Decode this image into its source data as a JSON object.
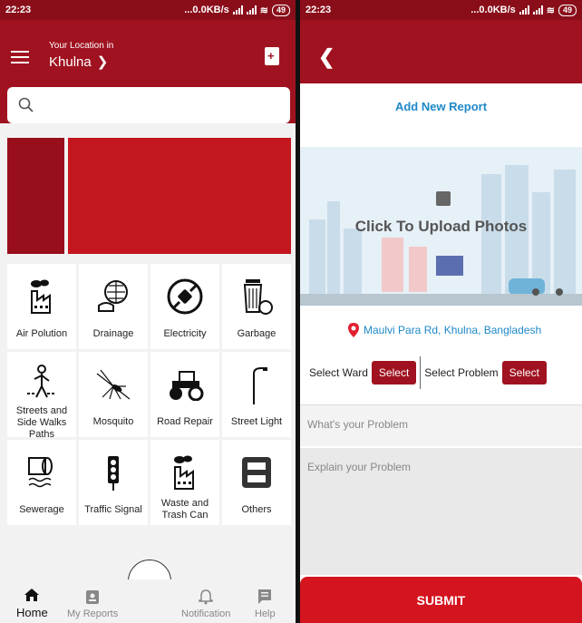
{
  "status_left": {
    "time": "22:23",
    "speed": "...0.0KB/s",
    "battery": "49"
  },
  "status_right": {
    "time": "22:23",
    "speed": "...0.0KB/s",
    "battery": "49"
  },
  "home": {
    "location_label": "Your Location in",
    "location_value": "Khulna",
    "search_placeholder": "",
    "categories": [
      {
        "label": "Air Polution",
        "icon": "factory-icon"
      },
      {
        "label": "Drainage",
        "icon": "drain-icon"
      },
      {
        "label": "Electricity",
        "icon": "plug-icon"
      },
      {
        "label": "Garbage",
        "icon": "trash-icon"
      },
      {
        "label": "Streets and Side Walks Paths",
        "icon": "pedestrian-icon"
      },
      {
        "label": "Mosquito",
        "icon": "mosquito-icon"
      },
      {
        "label": "Road Repair",
        "icon": "road-roller-icon"
      },
      {
        "label": "Street Light",
        "icon": "street-light-icon"
      },
      {
        "label": "Sewerage",
        "icon": "pipe-icon"
      },
      {
        "label": "Traffic Signal",
        "icon": "traffic-light-icon"
      },
      {
        "label": "Waste and Trash Can",
        "icon": "factory-icon"
      },
      {
        "label": "Others",
        "icon": "inbox-icon"
      }
    ],
    "nav": {
      "home": "Home",
      "reports": "My Reports",
      "notification": "Notification",
      "help": "Help"
    }
  },
  "report": {
    "title": "Add New Report",
    "upload_label": "Click To Upload Photos",
    "address": "Maulvi Para Rd, Khulna, Bangladesh",
    "ward_label": "Select Ward",
    "ward_button": "Select",
    "problem_label": "Select Problem",
    "problem_button": "Select",
    "problem_placeholder": "What's your Problem",
    "explain_placeholder": "Explain your Problem",
    "submit": "SUBMIT"
  },
  "colors": {
    "primary": "#a01220",
    "accent_blue": "#1e88c8",
    "submit_red": "#d4141e"
  }
}
